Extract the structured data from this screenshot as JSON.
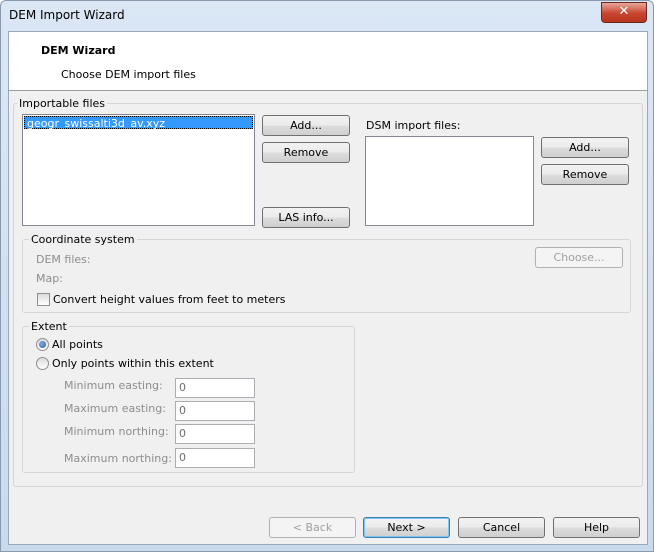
{
  "window": {
    "title": "DEM Import Wizard"
  },
  "header": {
    "title": "DEM Wizard",
    "subtitle": "Choose DEM import files"
  },
  "importable": {
    "group_label": "Importable files",
    "files": [
      "geogr_swissalti3d_av.xyz"
    ],
    "add_label": "Add...",
    "remove_label": "Remove",
    "las_info_label": "LAS info..."
  },
  "dsm": {
    "label": "DSM import files:",
    "add_label": "Add...",
    "remove_label": "Remove"
  },
  "coordinate": {
    "group_label": "Coordinate system",
    "dem_files_label": "DEM files:",
    "map_label": "Map:",
    "choose_label": "Choose...",
    "convert_label": "Convert height values from feet to meters",
    "convert_checked": false
  },
  "extent": {
    "group_label": "Extent",
    "all_points_label": "All points",
    "within_label": "Only points within this extent",
    "min_easting_label": "Minimum easting:",
    "max_easting_label": "Maximum easting:",
    "min_northing_label": "Minimum northing:",
    "max_northing_label": "Maximum northing:",
    "min_easting": "0",
    "max_easting": "0",
    "min_northing": "0",
    "max_northing": "0"
  },
  "footer": {
    "back_label": "< Back",
    "next_label": "Next >",
    "cancel_label": "Cancel",
    "help_label": "Help"
  }
}
